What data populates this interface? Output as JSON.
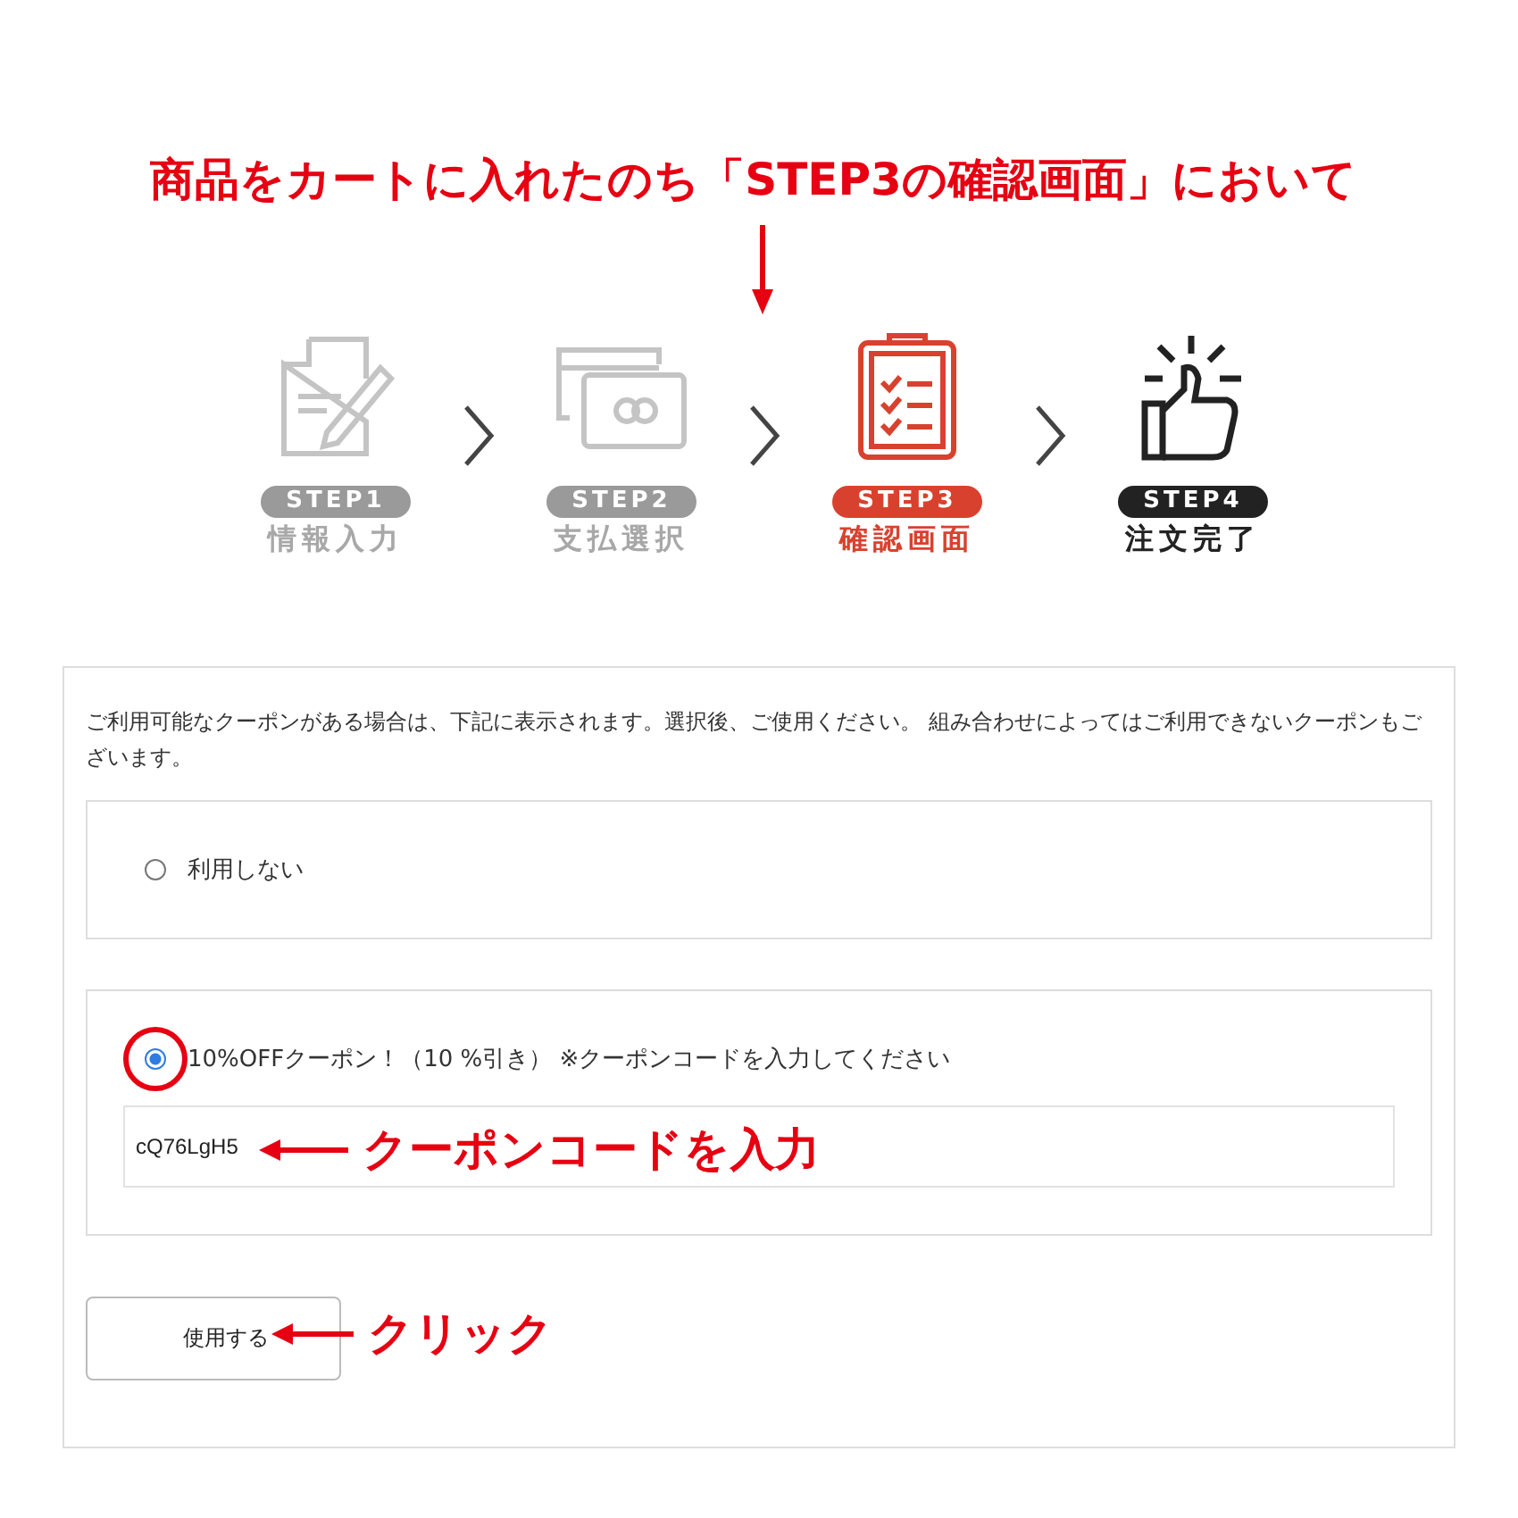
{
  "annotation_title": "商品をカートに入れたのち「STEP3の確認画面」において",
  "steps": [
    {
      "kind": "document",
      "badge": "STEP1",
      "label": "情報入力",
      "disabled": true,
      "selected": false
    },
    {
      "kind": "cards",
      "badge": "STEP2",
      "label": "支払選択",
      "disabled": true,
      "selected": false
    },
    {
      "kind": "clipboard",
      "badge": "STEP3",
      "label": "確認画面",
      "disabled": false,
      "selected": true
    },
    {
      "kind": "thumbs",
      "badge": "STEP4",
      "label": "注文完了",
      "disabled": false,
      "selected": false
    }
  ],
  "coupon_panel": {
    "notice": "ご利用可能なクーポンがある場合は、下記に表示されます。選択後、ご使用ください。 組み合わせによってはご利用できないクーポンもございます。",
    "options": [
      {
        "label": "利用しない",
        "selected": false
      },
      {
        "label": "10%OFFクーポン！（10 %引き） ※クーポンコードを入力してください",
        "selected": true,
        "code_field": {
          "value": "cQ76LgH5"
        }
      }
    ],
    "button": "使用する"
  },
  "annotations": {
    "code_note": "クーポンコードを入力",
    "click_note": "クリック"
  }
}
